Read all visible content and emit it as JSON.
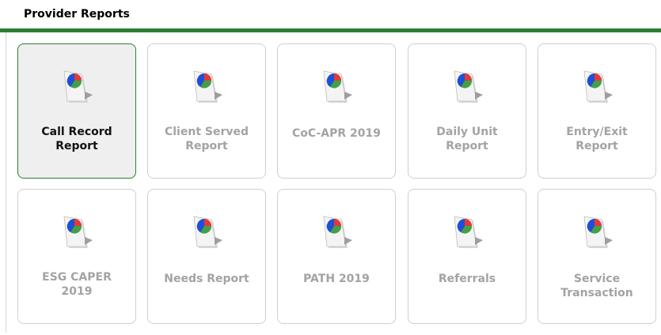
{
  "page": {
    "title": "Provider Reports"
  },
  "colors": {
    "accent": "#2e7d32",
    "tile_border": "#cfcfcf",
    "active_bg": "#efefef",
    "inactive_text": "#a3a3a3"
  },
  "reports": [
    {
      "label": "Call Record\nReport",
      "icon": "report-pie-chart-icon",
      "active": true
    },
    {
      "label": "Client Served\nReport",
      "icon": "report-pie-chart-icon",
      "active": false
    },
    {
      "label": "CoC-APR 2019",
      "icon": "report-pie-chart-icon",
      "active": false
    },
    {
      "label": "Daily Unit\nReport",
      "icon": "report-pie-chart-icon",
      "active": false
    },
    {
      "label": "Entry/Exit\nReport",
      "icon": "report-pie-chart-icon",
      "active": false
    },
    {
      "label": "ESG CAPER\n2019",
      "icon": "report-pie-chart-icon",
      "active": false
    },
    {
      "label": "Needs Report",
      "icon": "report-pie-chart-icon",
      "active": false
    },
    {
      "label": "PATH 2019",
      "icon": "report-pie-chart-icon",
      "active": false
    },
    {
      "label": "Referrals",
      "icon": "report-pie-chart-icon",
      "active": false
    },
    {
      "label": "Service\nTransaction",
      "icon": "report-pie-chart-icon",
      "active": false
    }
  ]
}
